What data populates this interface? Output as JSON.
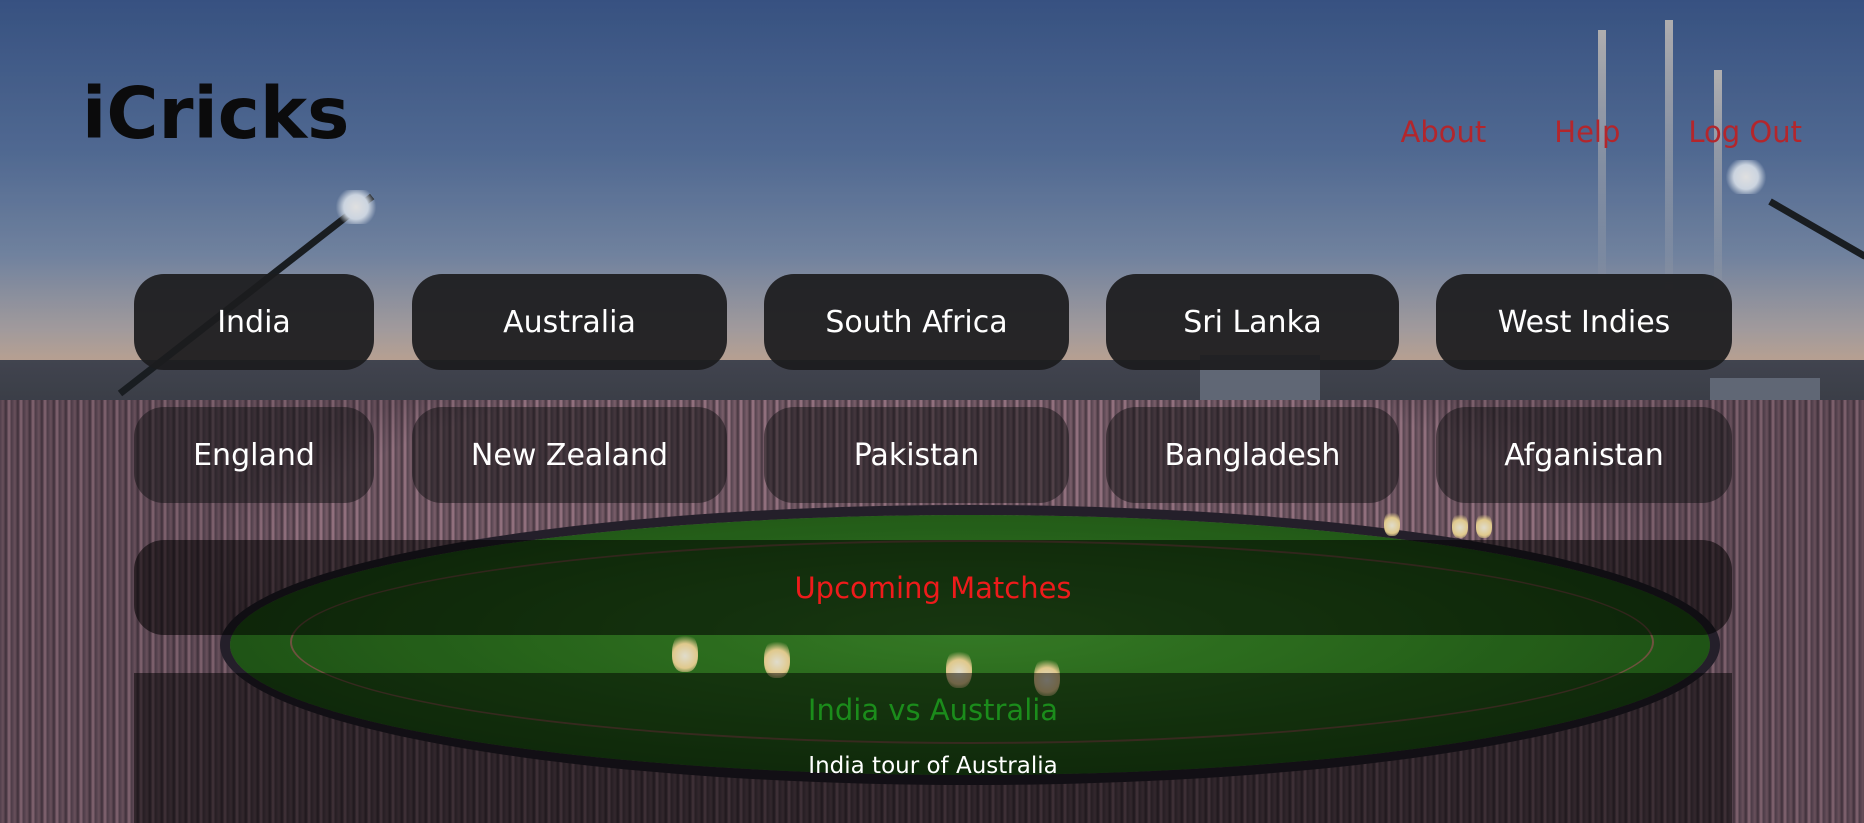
{
  "header": {
    "logo": "iCricks",
    "nav": [
      "About",
      "Help",
      "Log Out"
    ]
  },
  "teams": {
    "row1": [
      "India",
      "Australia",
      "South Africa",
      "Sri Lanka",
      "West Indies"
    ],
    "row2": [
      "England",
      "New Zealand",
      "Pakistan",
      "Bangladesh",
      "Afganistan"
    ]
  },
  "upcoming": {
    "heading": "Upcoming Matches",
    "matches": [
      {
        "title": "India vs Australia",
        "subtitle": "India tour of Australia"
      }
    ]
  },
  "colors": {
    "logo": "#0b0b0c",
    "nav_link": "#b3262c",
    "upcoming_heading": "#ee1b1b",
    "match_title": "#1b8c1b",
    "button_text": "#ffffff"
  }
}
